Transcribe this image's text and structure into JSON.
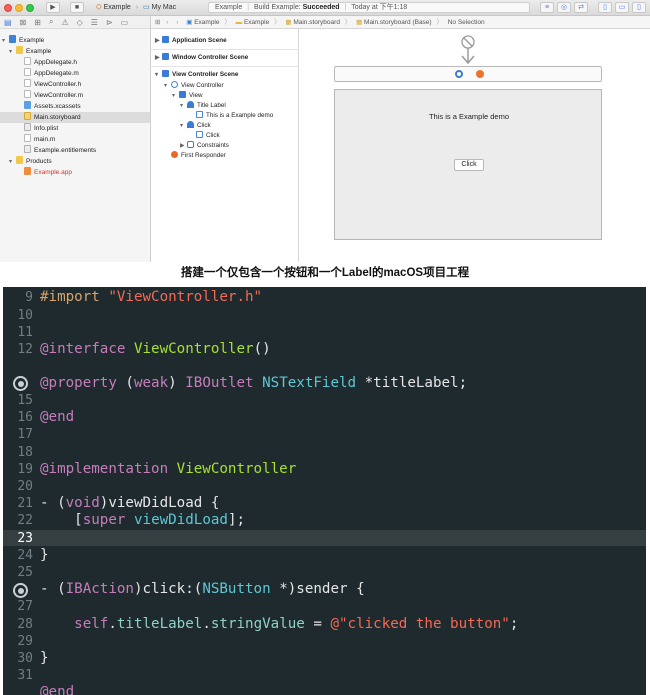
{
  "xcode": {
    "toolbar": {
      "scheme_app": "Example",
      "scheme_target": "My Mac",
      "activity_project": "Example",
      "activity_build_prefix": "Build Example:",
      "activity_build_status": "Succeeded",
      "activity_time": "Today at 下午1:18"
    },
    "navigator": {
      "items": [
        {
          "label": "Example",
          "icon": "project-icon"
        },
        {
          "label": "Example",
          "icon": "folder-icon"
        },
        {
          "label": "AppDelegate.h",
          "icon": "h-file-icon"
        },
        {
          "label": "AppDelegate.m",
          "icon": "m-file-icon"
        },
        {
          "label": "ViewController.h",
          "icon": "h-file-icon"
        },
        {
          "label": "ViewController.m",
          "icon": "m-file-icon"
        },
        {
          "label": "Assets.xcassets",
          "icon": "assets-icon"
        },
        {
          "label": "Main.storyboard",
          "icon": "storyboard-icon"
        },
        {
          "label": "Info.plist",
          "icon": "plist-icon"
        },
        {
          "label": "main.m",
          "icon": "m-file-icon"
        },
        {
          "label": "Example.entitlements",
          "icon": "entitlements-icon"
        },
        {
          "label": "Products",
          "icon": "folder-icon"
        },
        {
          "label": "Example.app",
          "icon": "app-icon"
        }
      ]
    },
    "jump_bar": [
      "Example",
      "Example",
      "Main.storyboard",
      "Main.storyboard (Base)",
      "No Selection"
    ],
    "outline": {
      "scene_app": "Application Scene",
      "scene_window": "Window Controller Scene",
      "scene_vc": "View Controller Scene",
      "vc": "View Controller",
      "view": "View",
      "title_label": "Title Label",
      "label_text": "This is a Example demo",
      "click_group": "Click",
      "click_cell": "Click",
      "constraints": "Constraints",
      "first_responder": "First Responder"
    },
    "canvas": {
      "demo_label": "This is a Example demo",
      "demo_button": "Click"
    }
  },
  "caption": "搭建一个仅包含一个按钮和一个Label的macOS项目工程",
  "code": {
    "line_numbers": [
      "9",
      "10",
      "11",
      "12",
      "",
      "15",
      "16",
      "17",
      "18",
      "19",
      "20",
      "21",
      "22",
      "23",
      "24",
      "25",
      "",
      "27",
      "28",
      "29",
      "30",
      "31"
    ],
    "current_line": "23",
    "l9_directive": "#import",
    "l9_string": "\"ViewController.h\"",
    "l12_kw": "@interface",
    "l12_class": "ViewController",
    "l12_rest": "()",
    "l14_kw": "@property",
    "l14_paren_open": "(",
    "l14_attr": "weak",
    "l14_paren_close": ")",
    "l14_outlet": "IBOutlet",
    "l14_type": "NSTextField",
    "l14_rest": "*titleLabel;",
    "l16_kw": "@end",
    "l19_kw": "@implementation",
    "l19_class": "ViewController",
    "l21_prefix": "- (",
    "l21_type": "void",
    "l21_rest": ")viewDidLoad {",
    "l22_bracket": "[",
    "l22_super": "super",
    "l22_method": "viewDidLoad",
    "l22_rest": "];",
    "l24_brace": "}",
    "l26_prefix": "- (",
    "l26_type": "IBAction",
    "l26_mid": ")click:(",
    "l26_type2": "NSButton",
    "l26_rest": "*)sender {",
    "l28_self": "self",
    "l28_dot1": ".",
    "l28_prop": "titleLabel",
    "l28_dot2": ".",
    "l28_prop2": "stringValue",
    "l28_eq": " = ",
    "l28_string": "@\"clicked the button\"",
    "l28_semi": ";",
    "l30_brace": "}",
    "l32_partial": "@end"
  }
}
